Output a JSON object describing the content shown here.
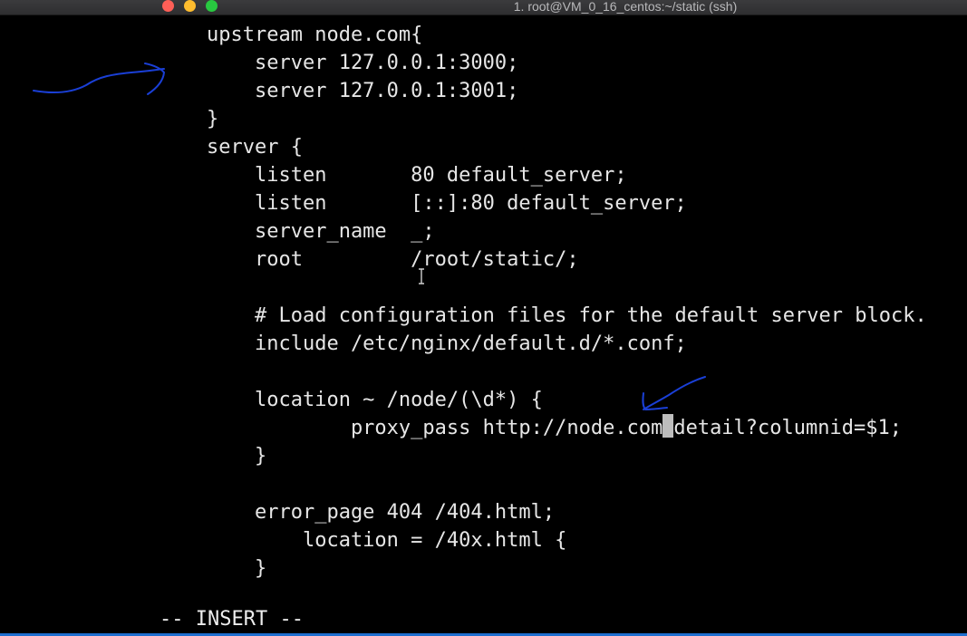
{
  "window": {
    "title": "1. root@VM_0_16_centos:~/static (ssh)"
  },
  "editor": {
    "lines": [
      "upstream node.com{",
      "    server 127.0.0.1:3000;",
      "    server 127.0.0.1:3001;",
      "}",
      "server {",
      "    listen       80 default_server;",
      "    listen       [::]:80 default_server;",
      "    server_name  _;",
      "    root         /root/static/;",
      "",
      "    # Load configuration files for the default server block.",
      "    include /etc/nginx/default.d/*.conf;",
      "",
      "    location ~ /node/(\\d*) {",
      "            proxy_pass http://node.com",
      "    }",
      "",
      "    error_page 404 /404.html;",
      "        location = /40x.html {",
      "    }"
    ],
    "proxy_pass_before_cursor": "            proxy_pass http://node.com",
    "cursor_char": "/",
    "proxy_pass_after_cursor": "detail?columnid=$1;"
  },
  "status": {
    "mode": "-- INSERT --"
  },
  "colors": {
    "background": "#000000",
    "text": "#e6e6e6",
    "annotation_ink": "#1a3fd6",
    "status_strip": "#1e6fd0"
  }
}
